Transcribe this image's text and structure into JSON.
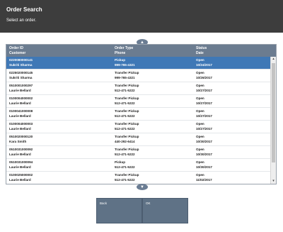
{
  "header": {
    "title": "Order Search",
    "subtitle": "Select an order."
  },
  "table": {
    "columns": [
      {
        "line1": "Order ID",
        "line2": "Customer"
      },
      {
        "line1": "Order Type",
        "line2": "Phone"
      },
      {
        "line1": "Status",
        "line2": "Date"
      }
    ],
    "rows": [
      {
        "order_id": "0220080000141",
        "customer": "Sukriti Sharma",
        "type": "Pickup",
        "phone": "999-765-4321",
        "status": "Open",
        "date": "10/24/2017",
        "selected": true
      },
      {
        "order_id": "0225020000145",
        "customer": "Sukriti Sharma",
        "type": "Transfer Pickup",
        "phone": "999-765-4321",
        "status": "Open",
        "date": "10/26/2017",
        "selected": false
      },
      {
        "order_id": "0510001000297",
        "customer": "Laurie Bellard",
        "type": "Transfer Pickup",
        "phone": "512-471-5222",
        "status": "Open",
        "date": "10/27/2017",
        "selected": false
      },
      {
        "order_id": "0100004000002",
        "customer": "Laurie Bellard",
        "type": "Transfer Pickup",
        "phone": "512-471-5222",
        "status": "Open",
        "date": "10/27/2017",
        "selected": false
      },
      {
        "order_id": "0100041000008",
        "customer": "Laurie Bellard",
        "type": "Transfer Pickup",
        "phone": "512-471-5222",
        "status": "Open",
        "date": "10/27/2017",
        "selected": false
      },
      {
        "order_id": "0100004000003",
        "customer": "Laurie Bellard",
        "type": "Transfer Pickup",
        "phone": "512-471-5222",
        "status": "Open",
        "date": "10/27/2017",
        "selected": false
      },
      {
        "order_id": "0510020000120",
        "customer": "Kara Smith",
        "type": "Transfer Pickup",
        "phone": "440-292-6414",
        "status": "Open",
        "date": "10/30/2017",
        "selected": false
      },
      {
        "order_id": "0510031000092",
        "customer": "Laurie Bellard",
        "type": "Transfer Pickup",
        "phone": "512-471-5222",
        "status": "Open",
        "date": "10/30/2017",
        "selected": false
      },
      {
        "order_id": "0510031000094",
        "customer": "Laurie Bellard",
        "type": "Pickup",
        "phone": "512-471-5222",
        "status": "Open",
        "date": "10/30/2017",
        "selected": false
      },
      {
        "order_id": "0100025000002",
        "customer": "Laurie Bellard",
        "type": "Transfer Pickup",
        "phone": "512-471-5222",
        "status": "Open",
        "date": "11/02/2017",
        "selected": false
      },
      {
        "order_id": "0551001000304",
        "customer": "Yu Su",
        "type": "Transfer Pickup",
        "phone": "512-332-4444",
        "status": "Open",
        "date": "11/07/2017",
        "selected": false
      }
    ]
  },
  "icons": {
    "scroll_up": "chevron-up-icon",
    "scroll_down": "chevron-down-icon"
  },
  "buttons": {
    "back_label": "Back",
    "ok_label": "OK"
  },
  "colors": {
    "header_bg": "#3d3d3d",
    "table_header_bg": "#6b7c90",
    "selected_row_bg": "#3f78b6",
    "button_bg": "#5f7286"
  }
}
